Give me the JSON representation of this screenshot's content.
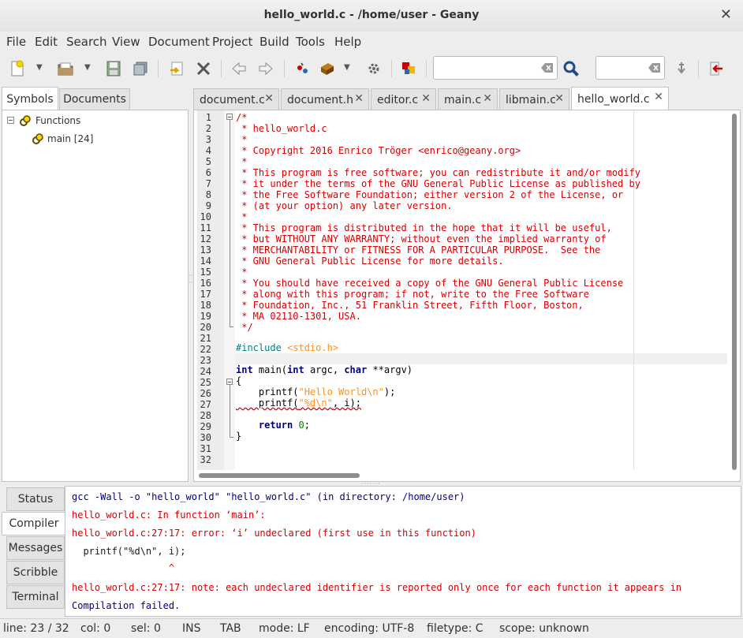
{
  "window": {
    "title": "hello_world.c - /home/user - Geany"
  },
  "menu": [
    "File",
    "Edit",
    "Search",
    "View",
    "Document",
    "Project",
    "Build",
    "Tools",
    "Help"
  ],
  "toolbar": {
    "buttons": [
      "new-icon",
      "open-icon",
      "save-icon",
      "save-all-icon",
      "revert-icon",
      "close-icon",
      "back-icon",
      "forward-icon",
      "compile-icon",
      "build-icon",
      "execute-icon",
      "color-chooser-icon",
      "search-icon",
      "goto-line-icon",
      "quit-icon"
    ],
    "search_value": "",
    "goto_value": ""
  },
  "sidebar": {
    "tabs": [
      "Symbols",
      "Documents"
    ],
    "tree": {
      "group": "Functions",
      "items": [
        "main [24]"
      ]
    }
  },
  "editor_tabs": [
    {
      "label": "document.c",
      "active": false
    },
    {
      "label": "document.h",
      "active": false
    },
    {
      "label": "editor.c",
      "active": false
    },
    {
      "label": "main.c",
      "active": false
    },
    {
      "label": "libmain.c",
      "active": false
    },
    {
      "label": "hello_world.c",
      "active": true
    }
  ],
  "editor": {
    "line_numbers": [
      "1",
      "2",
      "3",
      "4",
      "5",
      "6",
      "7",
      "8",
      "9",
      "10",
      "11",
      "12",
      "13",
      "14",
      "15",
      "16",
      "17",
      "18",
      "19",
      "20",
      "21",
      "22",
      "23",
      "24",
      "25",
      "26",
      "27",
      "28",
      "29",
      "30",
      "31",
      "32"
    ],
    "comment_lines": [
      "/*",
      " * hello_world.c",
      " *",
      " * Copyright 2016 Enrico Tröger <enrico@geany.org>",
      " *",
      " * This program is free software; you can redistribute it and/or modify",
      " * it under the terms of the GNU General Public License as published by",
      " * the Free Software Foundation; either version 2 of the License, or",
      " * (at your option) any later version.",
      " *",
      " * This program is distributed in the hope that it will be useful,",
      " * but WITHOUT ANY WARRANTY; without even the implied warranty of",
      " * MERCHANTABILITY or FITNESS FOR A PARTICULAR PURPOSE.  See the",
      " * GNU General Public License for more details.",
      " *",
      " * You should have received a copy of the GNU General Public License",
      " * along with this program; if not, write to the Free Software",
      " * Foundation, Inc., 51 Franklin Street, Fifth Floor, Boston,",
      " * MA 02110-1301, USA.",
      " */"
    ],
    "code": {
      "l22_pp": "#include",
      "l22_hdr": "<stdio.h>",
      "l24_kw1": "int",
      "l24_a": " main(",
      "l24_kw2": "int",
      "l24_b": " argc, ",
      "l24_kw3": "char",
      "l24_c": " **argv)",
      "l25": "{",
      "l26_a": "    printf(",
      "l26_str": "\"Hello World\\n\"",
      "l26_b": ");",
      "l27_a": "    printf(",
      "l27_str": "\"%d\\n\"",
      "l27_b": ", i);",
      "l29_kw": "return",
      "l29_num": "0",
      "l29_b": ";",
      "l30": "}"
    }
  },
  "bottom": {
    "tabs": [
      "Status",
      "Compiler",
      "Messages",
      "Scribble",
      "Terminal"
    ],
    "active_tab": "Compiler",
    "messages": [
      "gcc -Wall -o \"hello_world\" \"hello_world.c\" (in directory: /home/user)",
      "hello_world.c: In function ‘main’:",
      "hello_world.c:27:17: error: ‘i’ undeclared (first use in this function)",
      "  printf(\"%d\\n\", i);",
      "                 ^",
      "hello_world.c:27:17: note: each undeclared identifier is reported only once for each function it appears in",
      "Compilation failed."
    ]
  },
  "status": {
    "line": "line: 23 / 32",
    "col": "col: 0",
    "sel": "sel: 0",
    "ins": "INS",
    "tab": "TAB",
    "mode": "mode: LF",
    "encoding": "encoding: UTF-8",
    "filetype": "filetype: C",
    "scope": "scope: unknown"
  }
}
